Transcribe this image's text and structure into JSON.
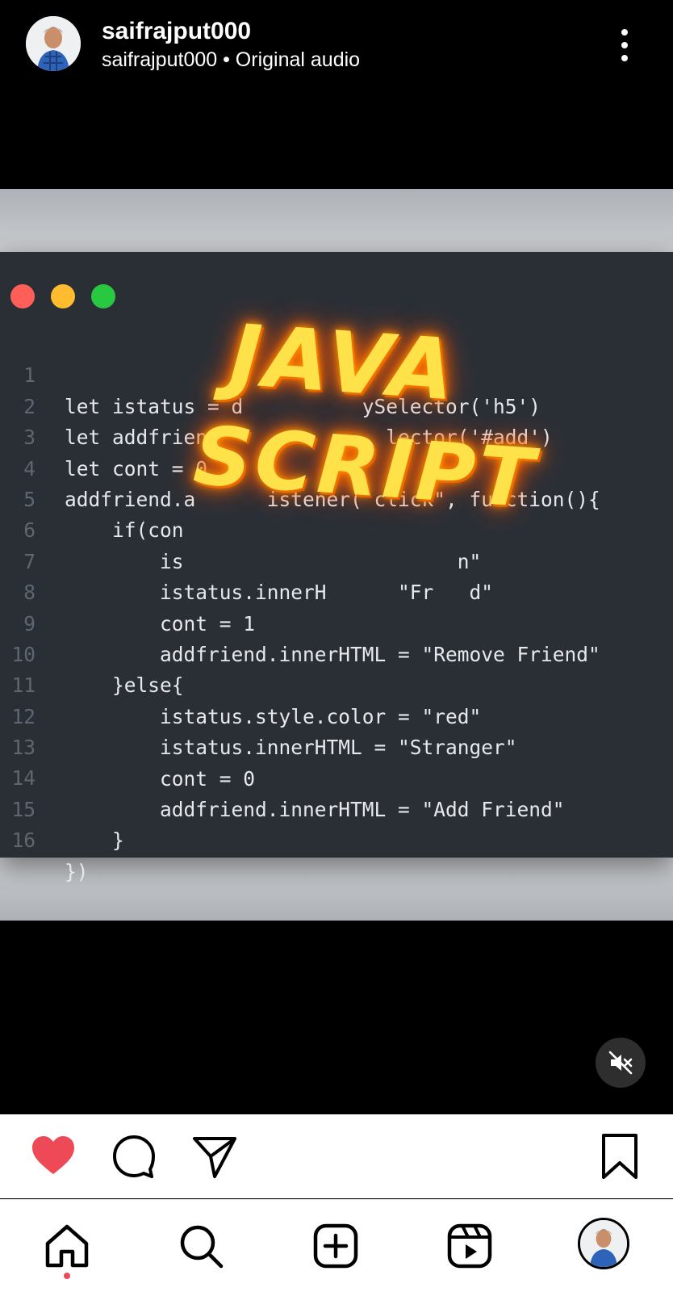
{
  "header": {
    "username": "saifrajput000",
    "subtitle": "saifrajput000 • Original audio",
    "more_icon": "more-vertical-icon"
  },
  "code_window": {
    "window_dots": [
      "#ff5f57",
      "#febc2e",
      "#28c840"
    ],
    "lines": [
      {
        "n": "1",
        "text": "let istatus = d          ySelector('h5')"
      },
      {
        "n": "2",
        "text": "let addfrienc              lector('#add')"
      },
      {
        "n": "3",
        "text": "let cont = 0"
      },
      {
        "n": "4",
        "text": "addfriend.a      istener(\"click\", function(){"
      },
      {
        "n": "5",
        "text": "    if(con"
      },
      {
        "n": "6",
        "text": "        is                       n\""
      },
      {
        "n": "7",
        "text": "        istatus.innerH      \"Fr   d\""
      },
      {
        "n": "8",
        "text": "        cont = 1"
      },
      {
        "n": "9",
        "text": "        addfriend.innerHTML = \"Remove Friend\""
      },
      {
        "n": "10",
        "text": "    }else{"
      },
      {
        "n": "11",
        "text": "        istatus.style.color = \"red\""
      },
      {
        "n": "12",
        "text": "        istatus.innerHTML = \"Stranger\""
      },
      {
        "n": "13",
        "text": "        cont = 0"
      },
      {
        "n": "14",
        "text": "        addfriend.innerHTML = \"Add Friend\""
      },
      {
        "n": "15",
        "text": "    }"
      },
      {
        "n": "16",
        "text": "})"
      }
    ]
  },
  "overlay": {
    "line1": "JAVA",
    "line2": "SCRIPT"
  },
  "mute_icon": "speaker-muted-icon",
  "actions": {
    "like_icon": "heart-icon",
    "liked": true,
    "comment_icon": "comment-icon",
    "share_icon": "send-icon",
    "save_icon": "bookmark-icon"
  },
  "nav": {
    "items": [
      "home-icon",
      "search-icon",
      "create-icon",
      "reels-icon",
      "profile-avatar"
    ],
    "active": "home-icon"
  },
  "colors": {
    "like": "#ed4956",
    "code_bg": "#2a2f36",
    "keyword": "#ea6f8f",
    "property": "#6fb0e6"
  }
}
